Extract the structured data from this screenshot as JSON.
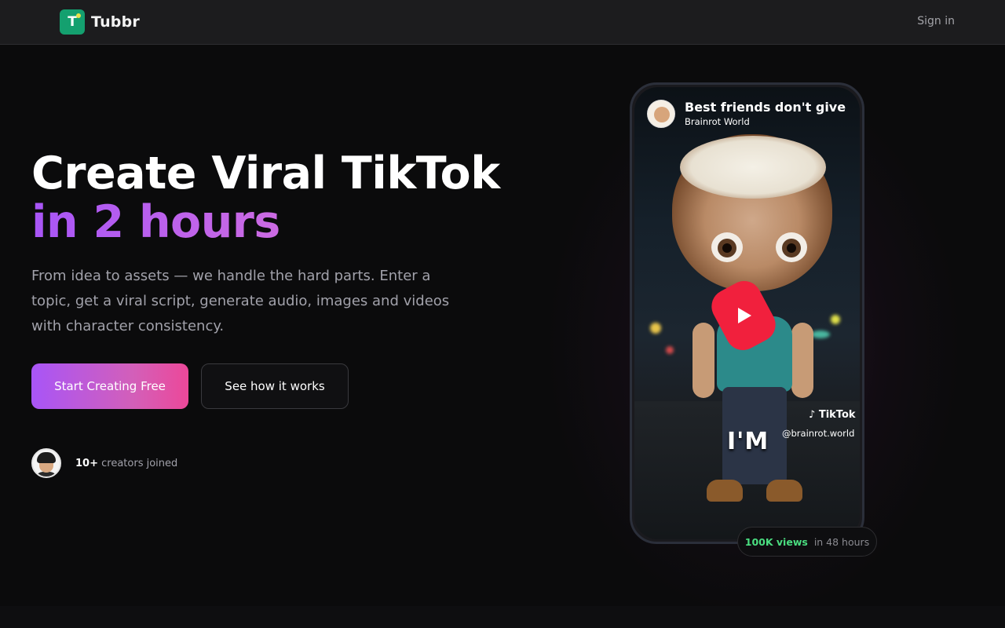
{
  "nav": {
    "logo_letter": "T",
    "brand": "Tubbr",
    "signin_label": "Sign in"
  },
  "hero": {
    "title_line1": "Create Viral TikTok",
    "title_line2": "in 2 hours",
    "subtitle": "From idea to assets — we handle the hard parts. Enter a topic, get a viral script, generate audio, images and videos with character consistency.",
    "primary_button": "Start Creating Free",
    "secondary_button": "See how it works",
    "joined_count": "10+",
    "joined_text": "creators joined"
  },
  "video": {
    "title": "Best friends don't give",
    "channel": "Brainrot World",
    "caption": "I'M",
    "tiktok_label": "TikTok",
    "tiktok_handle": "@brainrot.world"
  },
  "badge": {
    "views": "100K views",
    "period": "in 48 hours"
  },
  "colors": {
    "accent_purple": "#a855f7",
    "accent_pink": "#ec4899",
    "logo_green": "#14a06f",
    "views_green": "#4ade80"
  }
}
